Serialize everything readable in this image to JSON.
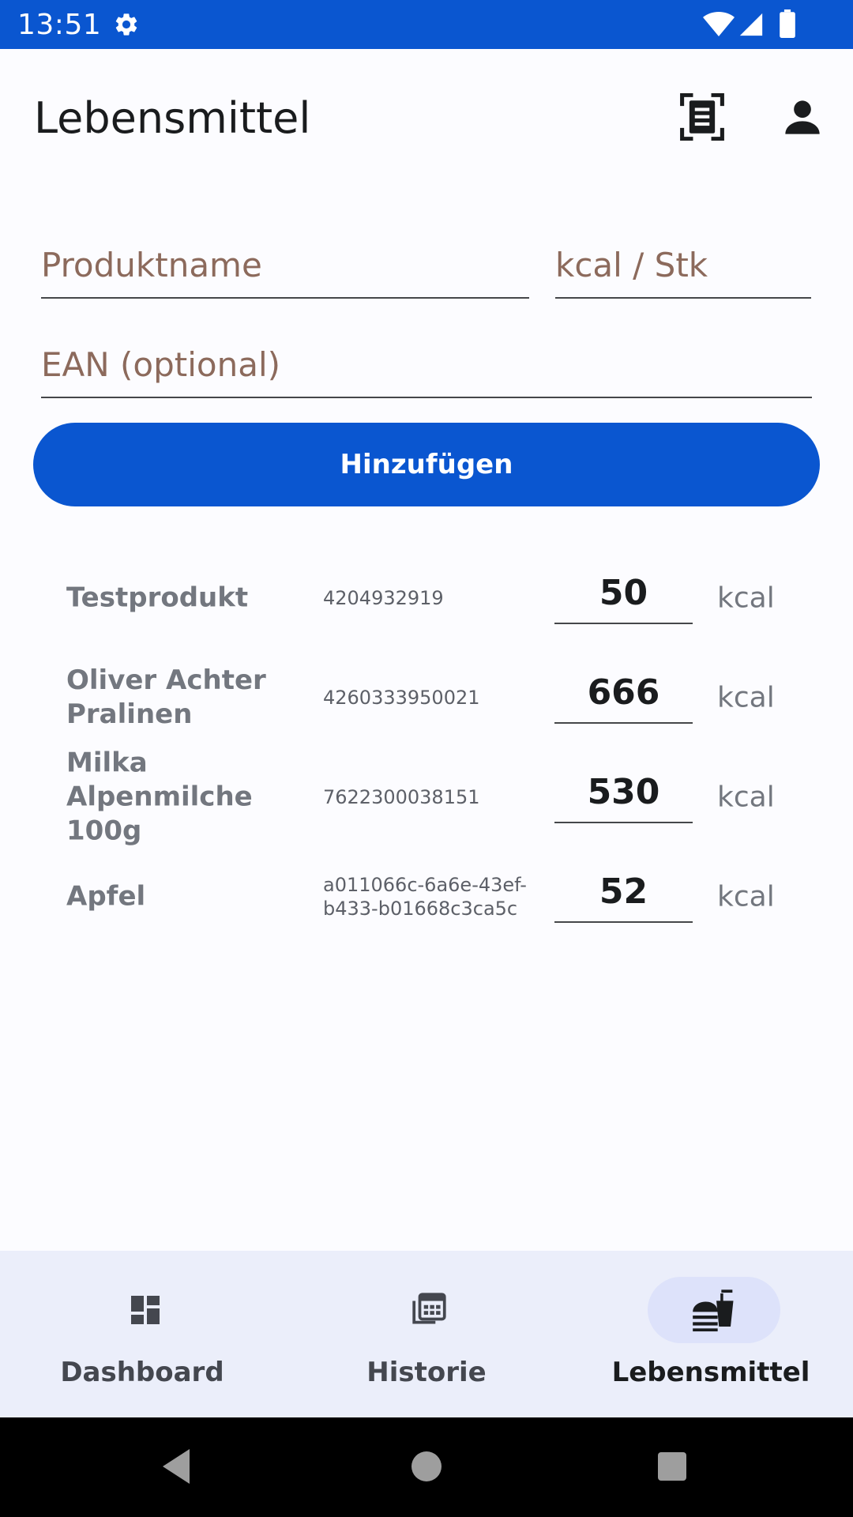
{
  "status_bar": {
    "time": "13:51"
  },
  "app_bar": {
    "title": "Lebensmittel"
  },
  "form": {
    "product_name_placeholder": "Produktname",
    "kcal_placeholder": "kcal / Stk",
    "ean_placeholder": "EAN (optional)",
    "add_button_label": "Hinzufügen"
  },
  "foods": [
    {
      "name": "Testprodukt",
      "ean": "4204932919",
      "kcal": "50",
      "unit": "kcal"
    },
    {
      "name": "Oliver Achter\nPralinen",
      "ean": "4260333950021",
      "kcal": "666",
      "unit": "kcal"
    },
    {
      "name": "Milka\nAlpenmilche 100g",
      "ean": "7622300038151",
      "kcal": "530",
      "unit": "kcal"
    },
    {
      "name": "Apfel",
      "ean": "a011066c-6a6e-43ef-b433-b01668c3ca5c",
      "kcal": "52",
      "unit": "kcal"
    }
  ],
  "bottom_nav": {
    "items": [
      {
        "label": "Dashboard",
        "icon": "dashboard-icon",
        "active": false
      },
      {
        "label": "Historie",
        "icon": "calendar-grid-icon",
        "active": false
      },
      {
        "label": "Lebensmittel",
        "icon": "fastfood-icon",
        "active": true
      }
    ]
  },
  "colors": {
    "primary": "#0a56d0",
    "nav_background": "#ebeefa",
    "nav_active_pill": "#dde2fa",
    "placeholder": "#8c6a5c"
  }
}
